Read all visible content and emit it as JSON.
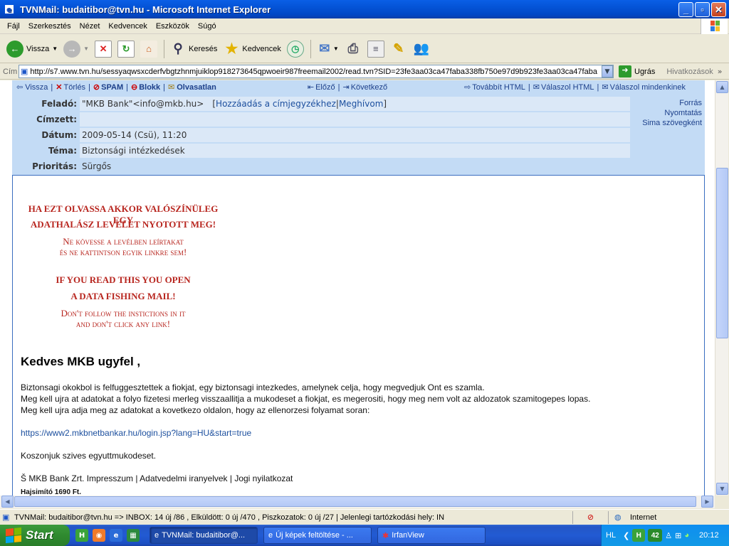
{
  "window": {
    "title": "TVNMail: budaitibor@tvn.hu - Microsoft Internet Explorer"
  },
  "menu": [
    "Fájl",
    "Szerkesztés",
    "Nézet",
    "Kedvencek",
    "Eszközök",
    "Súgó"
  ],
  "toolbar": {
    "back": "Vissza",
    "search": "Keresés",
    "favorites": "Kedvencek"
  },
  "address": {
    "label": "Cím",
    "url": "http://s7.www.tvn.hu/sessyaqwsxcderfvbgtzhnmjuiklop918273645qpwoeir987freemail2002/read.tvn?SID=23fe3aa03ca47faba338fb750e97d9b923fe3aa03ca47faba",
    "go": "Ugrás",
    "links": "Hivatkozások"
  },
  "mailnav": {
    "back": "Vissza",
    "delete": "Törlés",
    "spam": "SPAM",
    "block": "Blokk",
    "unread": "Olvasatlan",
    "prev": "Előző",
    "next": "Következő",
    "forward": "Továbbít HTML",
    "reply": "Válaszol HTML",
    "replyall": "Válaszol mindenkinek"
  },
  "header": {
    "from_label": "Feladó:",
    "from_value": "\"MKB Bank\"<info@mkb.hu>",
    "add_contact": "Hozzáadás a címjegyzékhez",
    "invite": "Meghívom",
    "to_label": "Címzett:",
    "to_value": "",
    "date_label": "Dátum:",
    "date_value": "2009-05-14 (Csü), 11:20",
    "subject_label": "Téma:",
    "subject_value": "Biztonsági intézkedések",
    "priority_label": "Prioritás:",
    "priority_value": "Sürgős",
    "source": "Forrás",
    "print": "Nyomtatás",
    "plain": "Sima szövegként"
  },
  "warning": {
    "hu1": "HA EZT OLVASSA AKKOR VALÓSZÍNÜLEG EGY",
    "hu2": "ADATHALÁSZ LEVELET NYOTOTT MEG!",
    "hu3": "Ne kövesse a levélben leírtakat",
    "hu4": "és ne kattintson egyik linkre sem!",
    "en1": "IF YOU READ THIS YOU OPEN",
    "en2": "A DATA FISHING MAIL!",
    "en3": "Don't follow the instictions in it",
    "en4": "and don't click any link!"
  },
  "mail": {
    "greeting": "Kedves MKB ugyfel ,",
    "p1": "Biztonsagi okokbol is felfuggesztettek a fiokjat, egy biztonsagi intezkedes, amelynek celja, hogy megvedjuk Ont es szamla.",
    "p2": "Meg kell ujra at adatokat a folyo fizetesi merleg visszaallitja a mukodeset a fiokjat, es megerositi, hogy meg nem volt az aldozatok szamitogepes lopas.",
    "p3": "Meg kell ujra adja meg az adatokat a kovetkezo oldalon, hogy az ellenorzesi folyamat soran:",
    "link": "https://www2.mkbnetbankar.hu/login.jsp?lang=HU&start=true",
    "thanks": "Koszonjuk szives egyuttmukodeset.",
    "footer": "Š MKB Bank Zrt. Impresszum | Adatvedelmi iranyelvek | Jogi nyilatkozat",
    "ad": "Hajsimító 1690 Ft."
  },
  "status": {
    "text": "TVNMail: budaitibor@tvn.hu => INBOX: 14 új /86 , Elküldött: 0 új /470 , Piszkozatok: 0 új /27 | Jelenlegi tartózkodási hely: IN",
    "zone": "Internet"
  },
  "taskbar": {
    "start": "Start",
    "tasks": [
      "TVNMail: budaitibor@...",
      "Új képek feltöltése - ...",
      "IrfanView"
    ],
    "lang": "HL",
    "counter": "42",
    "clock": "20:12"
  },
  "colors": {
    "warning": "#b8261f",
    "header_bg": "#c3dbf5",
    "link": "#1c4f9e"
  }
}
